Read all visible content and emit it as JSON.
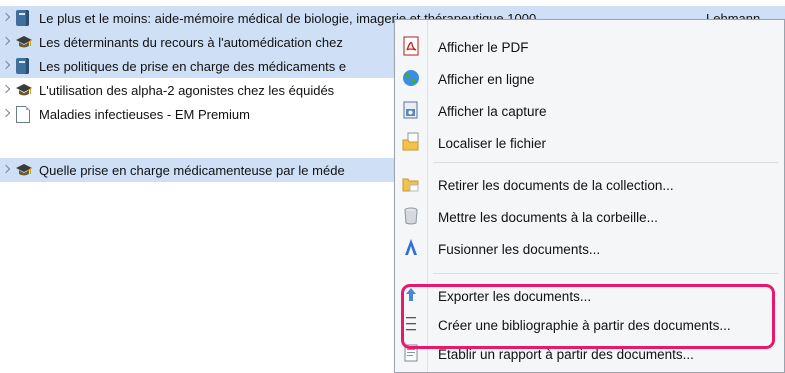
{
  "items": [
    {
      "icon": "book-icon",
      "title": "Le plus et le moins: aide-mémoire médical de biologie, imagerie et thérapeutique 1000",
      "creator": "Lehmann",
      "selected": true
    },
    {
      "icon": "thesis-icon",
      "title": "Les déterminants du recours à l'automédication chez",
      "creator": "",
      "selected": true
    },
    {
      "icon": "book-icon",
      "title": "Les politiques de prise en charge des médicaments e",
      "creator": "",
      "selected": true
    },
    {
      "icon": "thesis-icon",
      "title": "L'utilisation des alpha-2 agonistes chez les équidés",
      "creator": "",
      "selected": false
    },
    {
      "icon": "document-icon",
      "title": "Maladies infectieuses - EM Premium",
      "creator": "",
      "selected": false
    },
    {
      "icon": "thesis-icon",
      "title": "Quelle prise en charge médicamenteuse par le méde",
      "creator": "",
      "selected": true
    }
  ],
  "menu": {
    "view_pdf": "Afficher le PDF",
    "view_online": "Afficher en ligne",
    "view_snapshot": "Afficher la capture",
    "show_file": "Localiser le fichier",
    "remove_from_collection": "Retirer les documents de la collection...",
    "move_to_trash": "Mettre les documents à la corbeille...",
    "merge_items": "Fusionner les documents...",
    "export_items": "Exporter les documents...",
    "create_bibliography": "Créer une bibliographie à partir des documents...",
    "generate_report": "Établir un rapport à partir des documents..."
  },
  "colors": {
    "selection": "#cfe0f6",
    "highlight_border": "#e8196a",
    "menu_background": "#f4f6f8"
  }
}
